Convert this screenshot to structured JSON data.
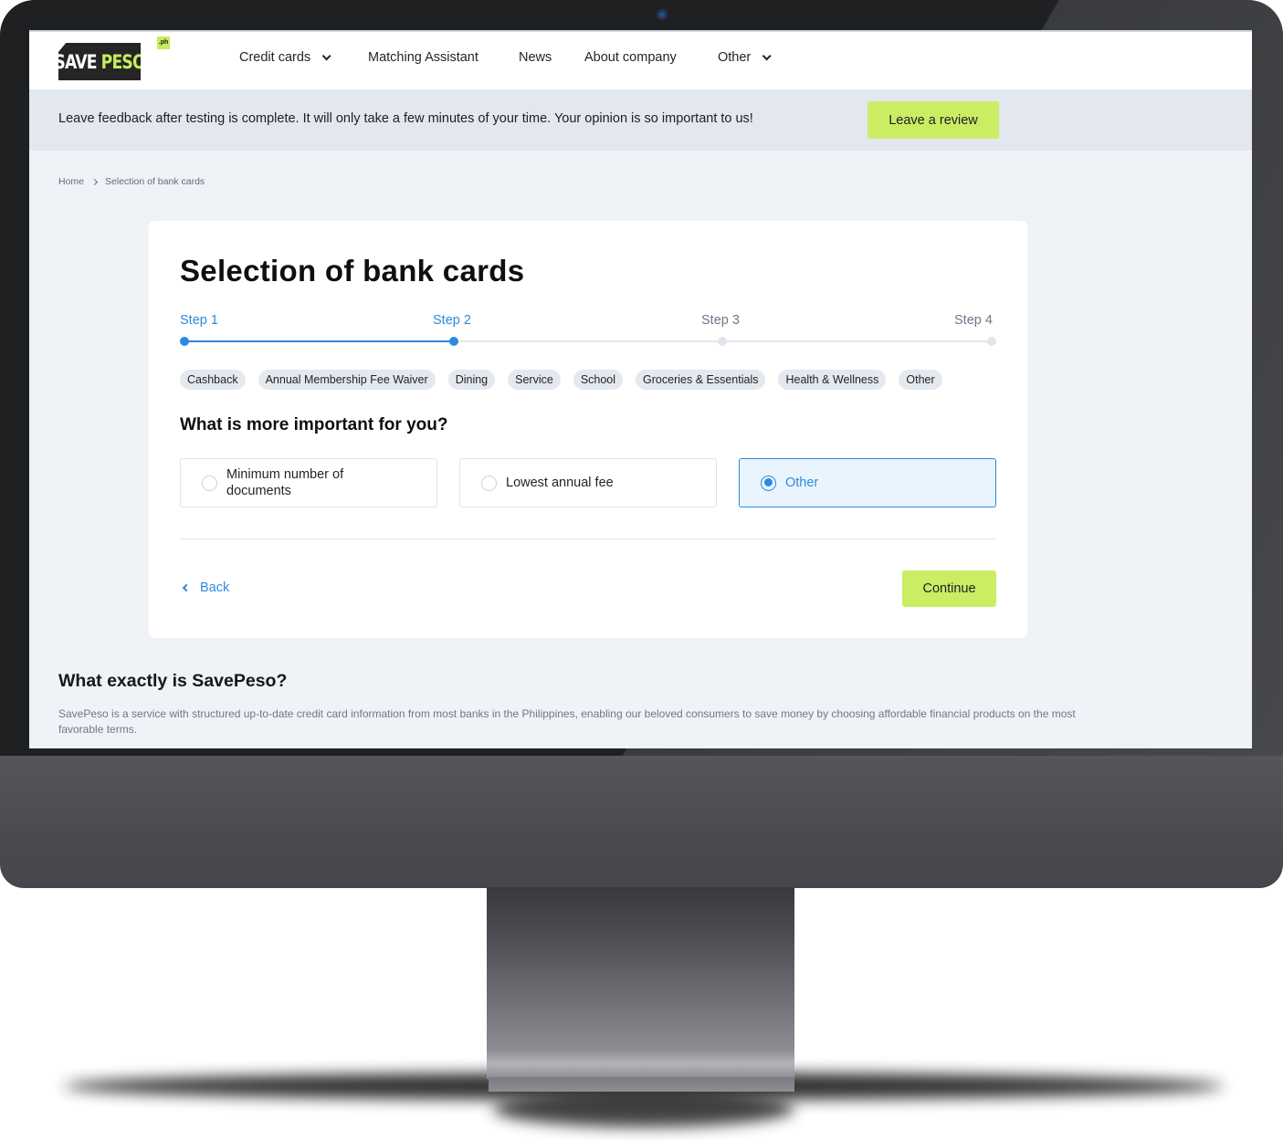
{
  "nav": {
    "logo": {
      "save": "SAVE",
      "peso": "PESO",
      "tld": ".ph"
    },
    "items": [
      {
        "label": "Credit cards",
        "has_dropdown": true
      },
      {
        "label": "Matching Assistant",
        "has_dropdown": false
      },
      {
        "label": "News",
        "has_dropdown": false
      },
      {
        "label": "About company",
        "has_dropdown": false
      },
      {
        "label": "Other",
        "has_dropdown": true
      }
    ]
  },
  "banner": {
    "text": "Leave feedback after testing is complete. It will only take a few minutes of your time. Your opinion is so important to us!",
    "button": "Leave a review"
  },
  "breadcrumb": [
    "Home",
    "Selection of bank cards"
  ],
  "wizard": {
    "title": "Selection of bank cards",
    "current_step": 2,
    "total_steps": 4,
    "steps": [
      {
        "label": "Step 1",
        "status": "done"
      },
      {
        "label": "Step 2",
        "status": "current"
      },
      {
        "label": "Step 3",
        "status": "todo"
      },
      {
        "label": "Step 4",
        "status": "todo"
      }
    ],
    "chips": [
      "Cashback",
      "Annual Membership Fee Waiver",
      "Dining",
      "Service",
      "School",
      "Groceries & Essentials",
      "Health & Wellness",
      "Other"
    ],
    "question": "What is more important for you?",
    "options": [
      {
        "label": "Minimum number of documents",
        "selected": false
      },
      {
        "label": "Lowest annual fee",
        "selected": false
      },
      {
        "label": "Other",
        "selected": true
      }
    ],
    "back_label": "Back",
    "continue_label": "Continue"
  },
  "about": {
    "title": "What exactly is SavePeso?",
    "text": "SavePeso is a service with structured up-to-date credit card information from most banks in the Philippines, enabling our beloved consumers to save money by choosing affordable financial products on the most favorable terms."
  },
  "colors": {
    "accent_blue": "#2b8be0",
    "lime": "#cbed63",
    "page_bg": "#eff2f7",
    "banner_bg": "#e3e7ef"
  }
}
